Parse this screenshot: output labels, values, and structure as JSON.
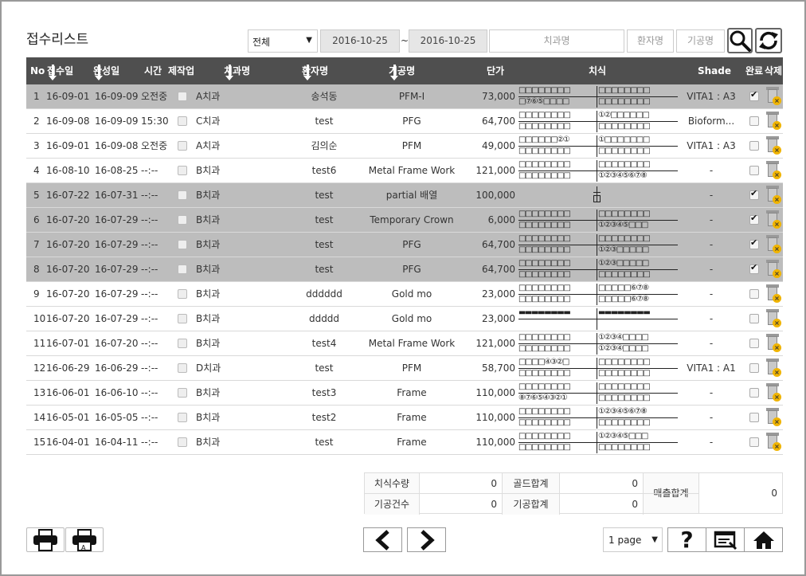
{
  "title": "접수리스트",
  "filters": {
    "status_selected": "전체",
    "date_from": "2016-10-25",
    "date_sep": "~",
    "date_to": "2016-10-25",
    "clinic_placeholder": "치과명",
    "patient_placeholder": "환자명",
    "lab_placeholder": "기공명"
  },
  "columns": [
    "No",
    "접수일",
    "완성일",
    "시간",
    "제작업",
    "치과명",
    "환자명",
    "기공명",
    "단가",
    "치식",
    "Shade",
    "완료",
    "삭제"
  ],
  "rows": [
    {
      "no": "1",
      "recv": "16-09-01",
      "done": "16-09-09",
      "time": "오전중",
      "clinic": "A치과",
      "patient": "송석동",
      "lab": "PFM-I",
      "price": "73,000",
      "shade": "VITA1 : A3",
      "complete": true,
      "ul": "□□□□□□□□",
      "ur": "□□□□□□□□",
      "ll": "□⑦⑥⑤□□□□",
      "lr": "□□□□□□□□"
    },
    {
      "no": "2",
      "recv": "16-09-08",
      "done": "16-09-09",
      "time": "15:30",
      "clinic": "C치과",
      "patient": "test",
      "lab": "PFG",
      "price": "64,700",
      "shade": "Bioform...",
      "complete": false,
      "ul": "□□□□□□□□",
      "ur": "①②□□□□□□",
      "ll": "□□□□□□□□",
      "lr": "□□□□□□□□"
    },
    {
      "no": "3",
      "recv": "16-09-01",
      "done": "16-09-08",
      "time": "오전중",
      "clinic": "A치과",
      "patient": "김의순",
      "lab": "PFM",
      "price": "49,000",
      "shade": "VITA1 : A3",
      "complete": false,
      "ul": "□□□□□□②①",
      "ur": "①□□□□□□□",
      "ll": "□□□□□□□□",
      "lr": "□□□□□□□□"
    },
    {
      "no": "4",
      "recv": "16-08-10",
      "done": "16-08-25",
      "time": "--:--",
      "clinic": "B치과",
      "patient": "test6",
      "lab": "Metal Frame Work",
      "price": "121,000",
      "shade": "-",
      "complete": false,
      "ul": "□□□□□□□□",
      "ur": "□□□□□□□□",
      "ll": "□□□□□□□□",
      "lr": "①②③④⑤⑥⑦⑧"
    },
    {
      "no": "5",
      "recv": "16-07-22",
      "done": "16-07-31",
      "time": "--:--",
      "clinic": "B치과",
      "patient": "test",
      "lab": "partial 배열",
      "price": "100,000",
      "shade": "-",
      "complete": true,
      "ul": "",
      "ur": "",
      "ll": "",
      "lr": ""
    },
    {
      "no": "6",
      "recv": "16-07-20",
      "done": "16-07-29",
      "time": "--:--",
      "clinic": "B치과",
      "patient": "test",
      "lab": "Temporary Crown",
      "price": "6,000",
      "shade": "-",
      "complete": true,
      "ul": "□□□□□□□□",
      "ur": "□□□□□□□□",
      "ll": "□□□□□□□□",
      "lr": "①②③④⑤□□□"
    },
    {
      "no": "7",
      "recv": "16-07-20",
      "done": "16-07-29",
      "time": "--:--",
      "clinic": "B치과",
      "patient": "test",
      "lab": "PFG",
      "price": "64,700",
      "shade": "-",
      "complete": true,
      "ul": "□□□□□□□□",
      "ur": "□□□□□□□□",
      "ll": "□□□□□□□□",
      "lr": "①②③□□□□□"
    },
    {
      "no": "8",
      "recv": "16-07-20",
      "done": "16-07-29",
      "time": "--:--",
      "clinic": "B치과",
      "patient": "test",
      "lab": "PFG",
      "price": "64,700",
      "shade": "-",
      "complete": true,
      "ul": "□□□□□□□□",
      "ur": "①②③□□□□□",
      "ll": "□□□□□□□□",
      "lr": "□□□□□□□□"
    },
    {
      "no": "9",
      "recv": "16-07-20",
      "done": "16-07-29",
      "time": "--:--",
      "clinic": "B치과",
      "patient": "dddddd",
      "lab": "Gold mo",
      "price": "23,000",
      "shade": "-",
      "complete": false,
      "ul": "□□□□□□□□",
      "ur": "□□□□□⑥⑦⑧",
      "ll": "□□□□□□□□",
      "lr": "□□□□□⑥⑦⑧"
    },
    {
      "no": "10",
      "recv": "16-07-20",
      "done": "16-07-29",
      "time": "--:--",
      "clinic": "B치과",
      "patient": "ddddd",
      "lab": "Gold mo",
      "price": "23,000",
      "shade": "-",
      "complete": false,
      "ul": "▬▬▬▬▬▬▬▬",
      "ur": "▬▬▬▬▬▬▬▬",
      "ll": "",
      "lr": ""
    },
    {
      "no": "11",
      "recv": "16-07-01",
      "done": "16-07-20",
      "time": "--:--",
      "clinic": "B치과",
      "patient": "test4",
      "lab": "Metal Frame Work",
      "price": "121,000",
      "shade": "-",
      "complete": false,
      "ul": "□□□□□□□□",
      "ur": "①②③④□□□□",
      "ll": "□□□□□□□□",
      "lr": "①②③④□□□□"
    },
    {
      "no": "12",
      "recv": "16-06-29",
      "done": "16-06-29",
      "time": "--:--",
      "clinic": "D치과",
      "patient": "test",
      "lab": "PFM",
      "price": "58,700",
      "shade": "VITA1 : A1",
      "complete": false,
      "ul": "□□□□④③②□",
      "ur": "□□□□□□□□",
      "ll": "□□□□□□□□",
      "lr": "□□□□□□□□"
    },
    {
      "no": "13",
      "recv": "16-06-01",
      "done": "16-06-10",
      "time": "--:--",
      "clinic": "B치과",
      "patient": "test3",
      "lab": "Frame",
      "price": "110,000",
      "shade": "-",
      "complete": false,
      "ul": "□□□□□□□□",
      "ur": "□□□□□□□□",
      "ll": "⑧⑦⑥⑤④③②①",
      "lr": "□□□□□□□□"
    },
    {
      "no": "14",
      "recv": "16-05-01",
      "done": "16-05-05",
      "time": "--:--",
      "clinic": "B치과",
      "patient": "test2",
      "lab": "Frame",
      "price": "110,000",
      "shade": "-",
      "complete": false,
      "ul": "□□□□□□□□",
      "ur": "①②③④⑤⑥⑦⑧",
      "ll": "□□□□□□□□",
      "lr": "□□□□□□□□"
    },
    {
      "no": "15",
      "recv": "16-04-01",
      "done": "16-04-11",
      "time": "--:--",
      "clinic": "B치과",
      "patient": "test",
      "lab": "Frame",
      "price": "110,000",
      "shade": "-",
      "complete": false,
      "ul": "□□□□□□□□",
      "ur": "①②③④⑤□□□",
      "ll": "□□□□□□□□",
      "lr": "□□□□□□□□"
    }
  ],
  "summary": {
    "tooth_count_label": "치식수량",
    "tooth_count": "0",
    "gold_total_label": "골드합계",
    "gold_total": "0",
    "lab_count_label": "기공건수",
    "lab_count": "0",
    "lab_total_label": "기공합계",
    "lab_total": "0",
    "sales_total_label": "매출합계",
    "sales_total": "0"
  },
  "pager": {
    "selected": "1 page"
  },
  "icons": {
    "print": "printer-icon",
    "print_alt": "printer-a-icon",
    "prev": "chevron-left-icon",
    "next": "chevron-right-icon",
    "help": "question-icon",
    "receipt": "receipt-icon",
    "home": "home-icon",
    "search": "search-icon",
    "refresh": "refresh-icon",
    "delete": "trash-delete-icon"
  },
  "colors": {
    "header_bg": "#4f4f4f",
    "row_highlight": "#bdbdbd",
    "delete_badge": "#f0b400"
  }
}
